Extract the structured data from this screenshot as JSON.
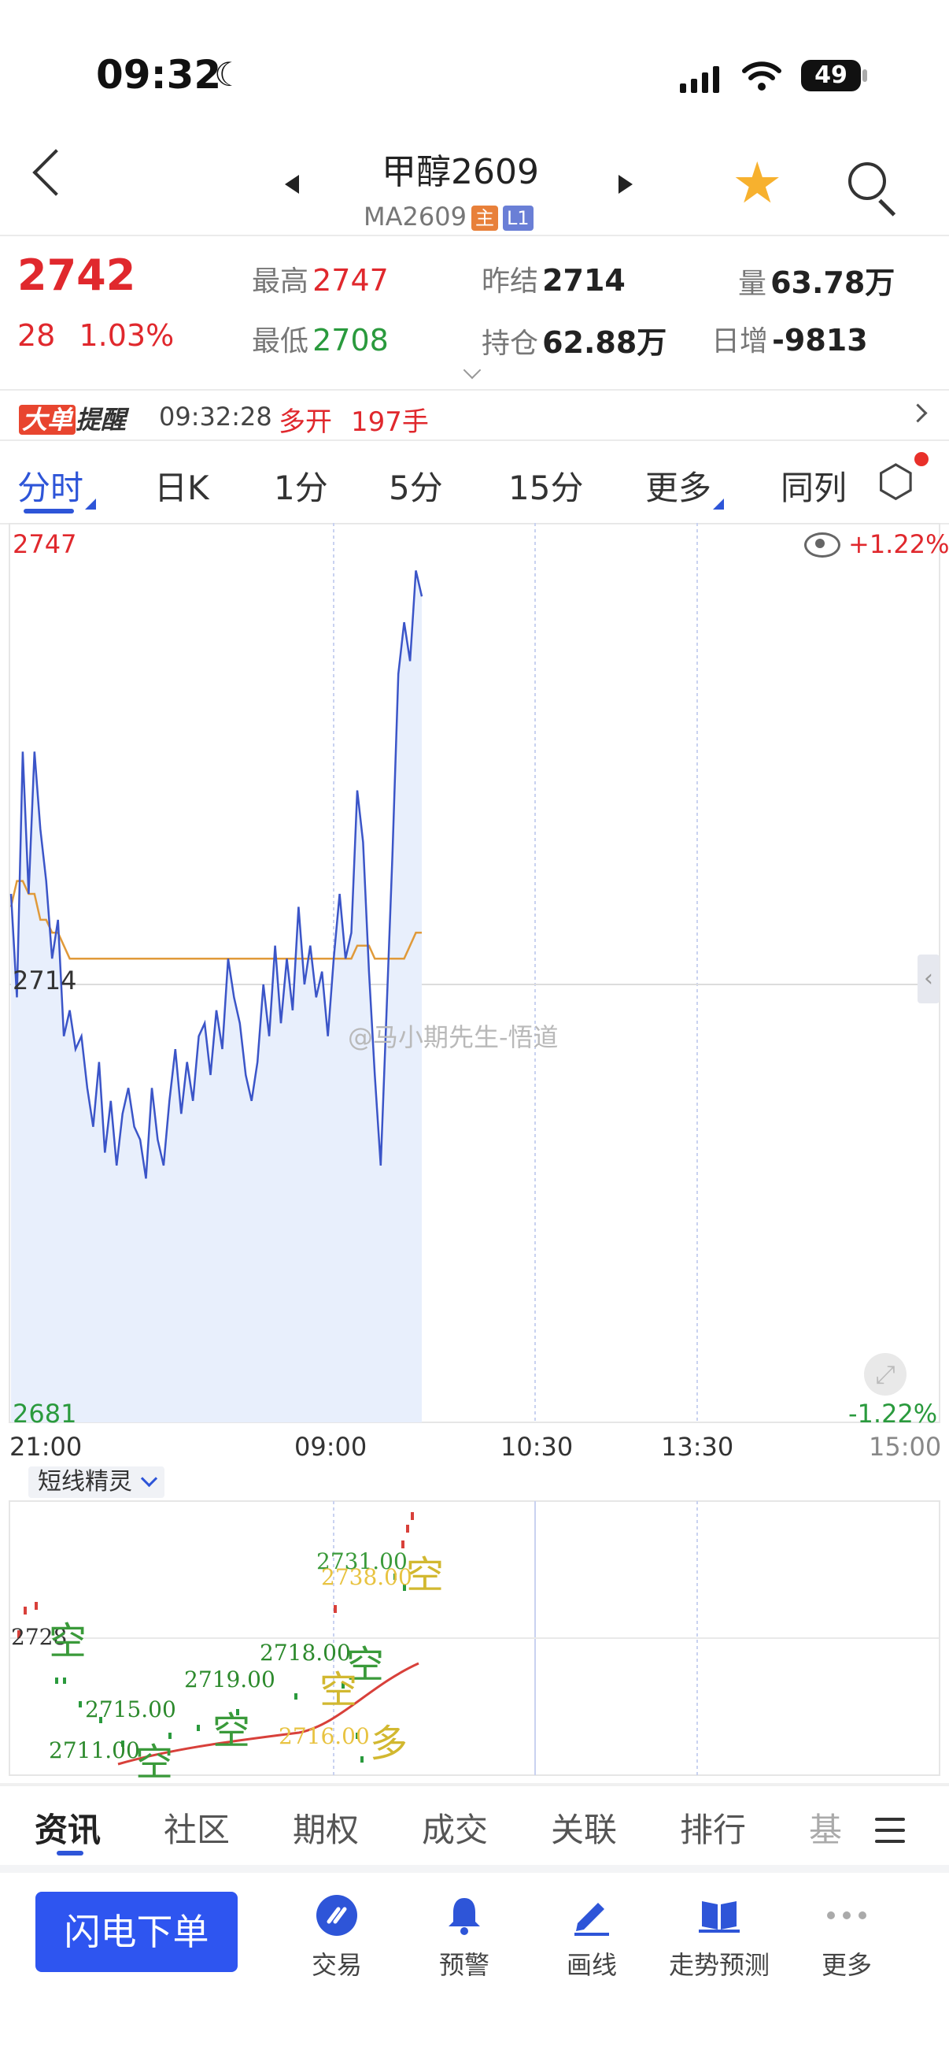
{
  "status_bar": {
    "time": "09:32",
    "battery": "49"
  },
  "header": {
    "title": "甲醇2609",
    "subtitle": "MA2609",
    "badge_main": "主",
    "badge_level": "L1"
  },
  "quote": {
    "last_price": "2742",
    "change": "28",
    "change_pct": "1.03%",
    "high_label": "最高",
    "high": "2747",
    "low_label": "最低",
    "low": "2708",
    "prev_settle_label": "昨结",
    "prev_settle": "2714",
    "open_interest_label": "持仓",
    "open_interest": "62.88万",
    "volume_label": "量",
    "volume": "63.78万",
    "daily_increase_label": "日增",
    "daily_increase": "-9813"
  },
  "alert": {
    "tag_big": "大单",
    "tag_remind": "提醒",
    "time": "09:32:28",
    "direction": "多开",
    "quantity": "197手"
  },
  "chart_tabs": [
    "分时",
    "日K",
    "1分",
    "5分",
    "15分",
    "更多",
    "同列"
  ],
  "colors": {
    "up": "#e0282d",
    "down": "#2a9a3d",
    "accent": "#2e55d8",
    "price_line": "#3b55c8",
    "avg_line": "#e09a3a"
  },
  "chart_data": {
    "type": "line",
    "x_ticks": [
      "21:00",
      "09:00",
      "10:30",
      "13:30",
      "15:00"
    ],
    "y_top": "2747",
    "y_mid": "2714",
    "y_bottom": "2681",
    "pct_top": "+1.22%",
    "pct_bottom": "-1.22%",
    "ylim": [
      2681,
      2747
    ],
    "prev_settle": 2714,
    "price_series": [
      2721,
      2713,
      2732,
      2721,
      2732,
      2726,
      2722,
      2716,
      2719,
      2710,
      2712,
      2709,
      2710,
      2706,
      2703,
      2708,
      2701,
      2705,
      2700,
      2704,
      2706,
      2703,
      2702,
      2699,
      2706,
      2702,
      2700,
      2705,
      2709,
      2704,
      2708,
      2705,
      2710,
      2711,
      2707,
      2712,
      2709,
      2716,
      2713,
      2711,
      2707,
      2705,
      2708,
      2714,
      2710,
      2717,
      2711,
      2716,
      2712,
      2720,
      2714,
      2717,
      2713,
      2715,
      2710,
      2716,
      2721,
      2716,
      2718,
      2729,
      2725,
      2715,
      2707,
      2700,
      2712,
      2724,
      2738,
      2742,
      2739,
      2746,
      2744
    ],
    "avg_series": [
      2720,
      2722,
      2722,
      2721,
      2721,
      2719,
      2719,
      2718,
      2718,
      2717,
      2716,
      2716,
      2716,
      2716,
      2716,
      2716,
      2716,
      2716,
      2716,
      2716,
      2716,
      2716,
      2716,
      2716,
      2716,
      2716,
      2716,
      2716,
      2716,
      2716,
      2716,
      2716,
      2716,
      2716,
      2716,
      2716,
      2716,
      2716,
      2716,
      2716,
      2716,
      2716,
      2716,
      2716,
      2716,
      2716,
      2716,
      2716,
      2716,
      2716,
      2716,
      2716,
      2716,
      2716,
      2716,
      2716,
      2716,
      2716,
      2716,
      2717,
      2717,
      2717,
      2716,
      2716,
      2716,
      2716,
      2716,
      2716,
      2717,
      2718,
      2718
    ]
  },
  "watermark": "@马小期先生-悟道",
  "indicator": {
    "name": "短线精灵",
    "signals": [
      {
        "price": "2731.00",
        "side": "空",
        "kind": "short"
      },
      {
        "price": "2738.00",
        "side": "",
        "kind": "long"
      },
      {
        "price": "2728",
        "side": "空",
        "kind": "short"
      },
      {
        "price": "2718.00",
        "side": "空",
        "kind": "short"
      },
      {
        "price": "2719.00",
        "side": "空",
        "kind": "short"
      },
      {
        "price": "2716.00",
        "side": "多",
        "kind": "long"
      },
      {
        "price": "2715.00",
        "side": "空",
        "kind": "short"
      },
      {
        "price": "2711.00",
        "side": "空",
        "kind": "short"
      }
    ]
  },
  "bottom_tabs": [
    "资讯",
    "社区",
    "期权",
    "成交",
    "关联",
    "排行",
    "基"
  ],
  "actions": {
    "flash_order": "闪电下单",
    "trade": "交易",
    "alert": "预警",
    "draw": "画线",
    "forecast": "走势预测",
    "more": "更多"
  }
}
